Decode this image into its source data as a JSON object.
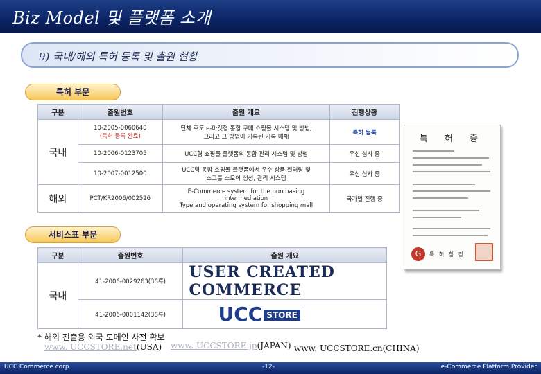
{
  "header": {
    "title": "Biz Model 및 플랫폼 소개"
  },
  "section_title": "9) 국내/해외 특허 등록 및 출원 현황",
  "patent": {
    "pill": "특허 부문",
    "headers": {
      "type": "구분",
      "number": "출원번호",
      "summary": "출원 개요",
      "status": "진행상황"
    },
    "domestic_label": "국내",
    "overseas_label": "해외",
    "rows": [
      {
        "number": "10-2005-0060640",
        "number_note": "(특허 등록 완료)",
        "summary1": "단체 주도 e-마켓형 통합 구매 쇼핑몰 시스템 및 방법,",
        "summary2": "그리고 그 방법이 기록된 기록 매체",
        "status": "특허 등록"
      },
      {
        "number": "10-2006-0123705",
        "summary1": "UCC형 쇼핑몰 플랫폼의 통합 관리 시스템 및 방법",
        "status": "우선 심사 중"
      },
      {
        "number": "10-2007-0012500",
        "summary1": "UCC형 통합 쇼핑몰 플랫폼에서 우수 상품 필터링 및",
        "summary2": "소그룹 스토어 생성, 관리 시스템",
        "status": "우선 심사 중"
      },
      {
        "number": "PCT/KR2006/002526",
        "summary1": "E-Commerce system for the purchasing",
        "summary2": "intermediation",
        "summary3": "Type and operating system for shopping mall",
        "status": "국가별 진행 중"
      }
    ]
  },
  "certificate": {
    "title": "특 허 증",
    "footer": "특 허 청 장"
  },
  "service": {
    "pill": "서비스표 부문",
    "headers": {
      "type": "구분",
      "number": "출원번호",
      "summary": "출원 개요"
    },
    "domestic_label": "국내",
    "rows": [
      {
        "number": "41-2006-0029263(38류)",
        "logo": "USER CREATED COMMERCE"
      },
      {
        "number": "41-2006-0001142(38류)",
        "logo_main": "UCC",
        "logo_sub": "STORE"
      }
    ]
  },
  "note": "* 해외 진출용 외국 도메인 사전 확보",
  "domains": [
    {
      "link": "www. UCCSTORE.net",
      "country": "(USA)"
    },
    {
      "link": "www. UCCSTORE.jp",
      "country": "(JAPAN)"
    },
    {
      "text": "www. UCCSTORE.cn(CHINA)"
    }
  ],
  "footer": {
    "company": "UCC Commerce corp",
    "page": "-12-",
    "tagline": "e-Commerce Platform Provider"
  }
}
